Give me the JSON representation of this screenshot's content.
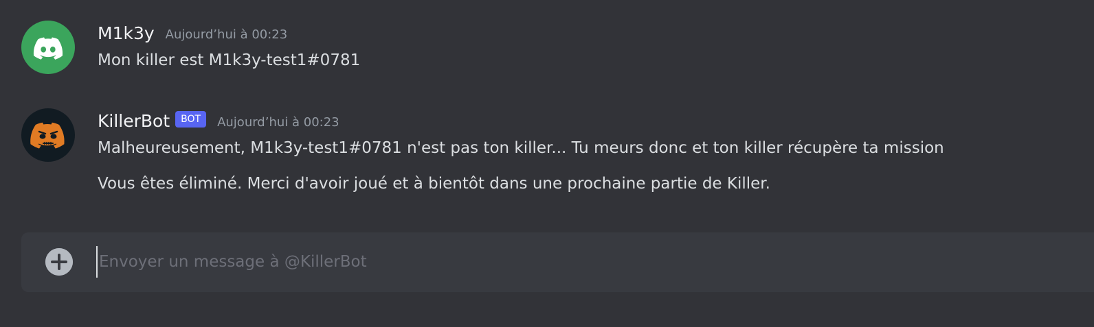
{
  "messages": [
    {
      "author": "M1k3y",
      "timestamp": "Aujourd’hui à 00:23",
      "avatar_icon": "discord-logo-icon",
      "avatar_color": "#3ba55c",
      "lines": [
        "Mon killer est M1k3y-test1#0781"
      ]
    },
    {
      "author": "KillerBot",
      "bot_badge": "BOT",
      "timestamp": "Aujourd’hui à 00:23",
      "avatar_icon": "killerbot-avatar-icon",
      "avatar_color": "#e07b24",
      "lines": [
        "Malheureusement, M1k3y-test1#0781 n'est pas ton killer... Tu meurs donc et ton killer récupère ta mission",
        "Vous êtes éliminé. Merci d'avoir joué et à bientôt dans une prochaine partie de Killer."
      ]
    }
  ],
  "composer": {
    "placeholder": "Envoyer un message à @KillerBot",
    "value": "",
    "add_icon": "plus-circle-icon"
  },
  "colors": {
    "background": "#323338",
    "composer_background": "#383a40",
    "bot_badge": "#5865f2",
    "timestamp": "#949ba4"
  }
}
